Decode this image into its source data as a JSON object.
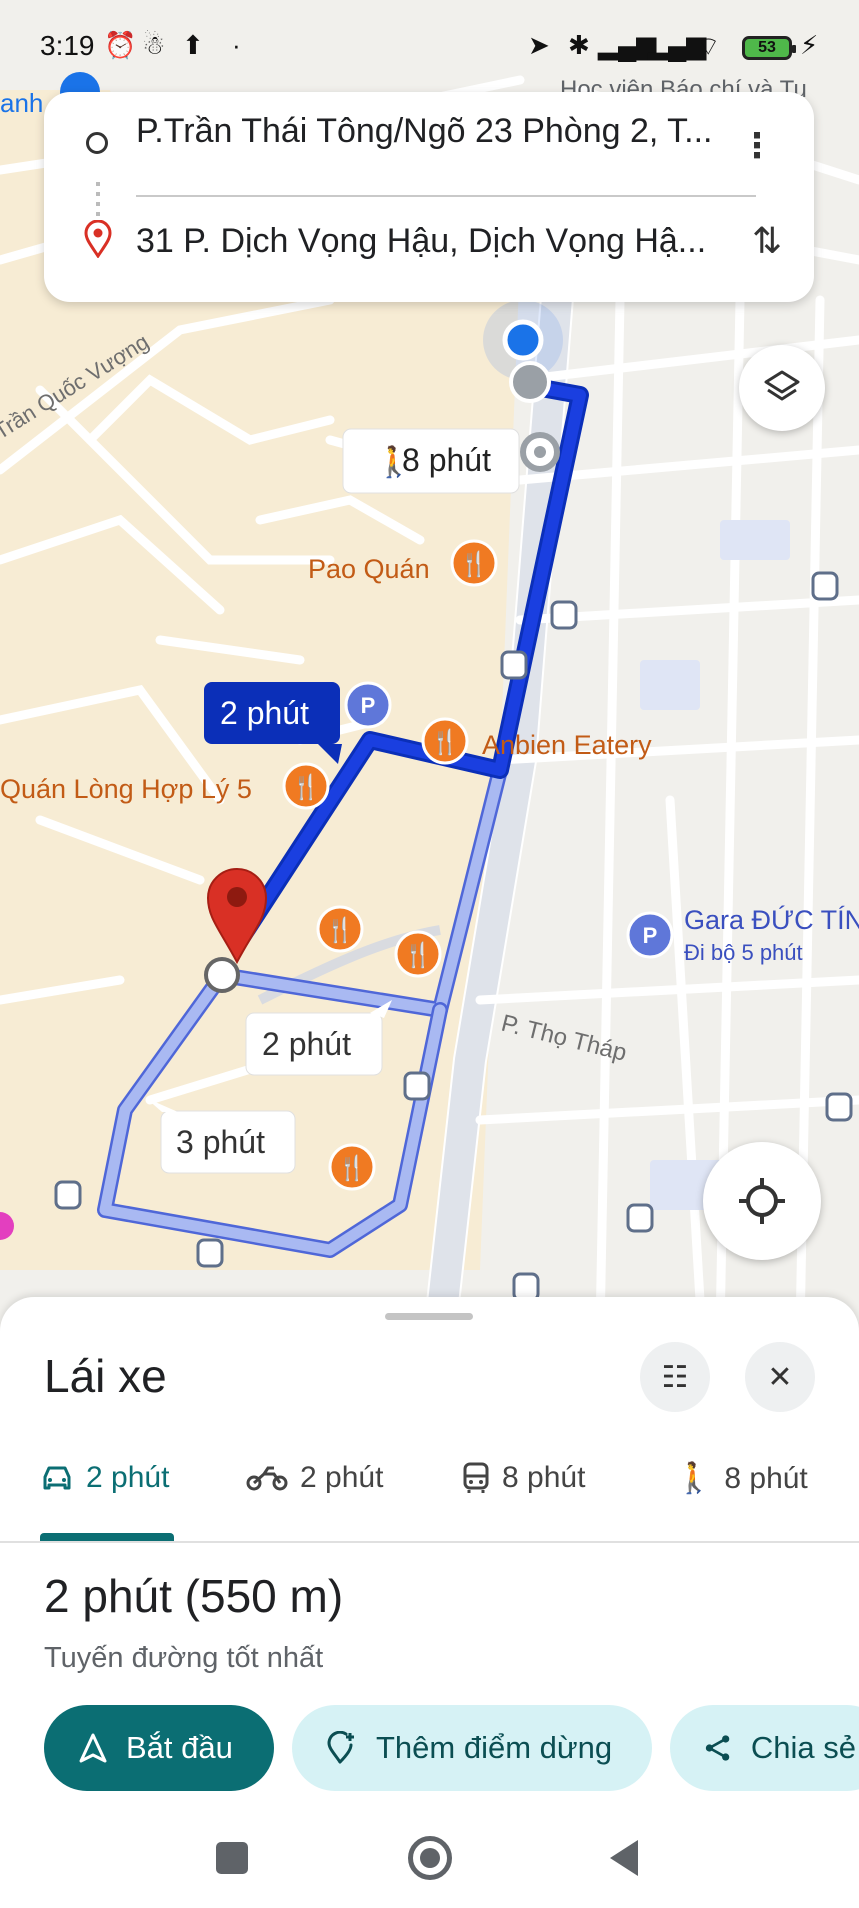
{
  "status_bar": {
    "time": "3:19",
    "battery": "53"
  },
  "search": {
    "origin": "P.Trần Thái Tông/Ngõ 23 Phòng 2, T...",
    "destination": "31 P. Dịch Vọng Hậu, Dịch Vọng Hậ..."
  },
  "map": {
    "labels": {
      "street_tran_quoc_vuong": "Trần Quốc Vượng",
      "top_left_partial": "anh",
      "top_right_place": "Học viện Báo chí và Tu",
      "pao_quan": "Pao Quán",
      "anbien": "Anbien Eatery",
      "quan_long": "Quán Lòng Hợp Lý 5",
      "gara": "Gara ĐỨC TÍN",
      "gara_walk": "Đi bộ 5 phút",
      "tho_thap": "P. Thọ Tháp"
    },
    "callouts": {
      "walk": "8 phút",
      "selected": "2 phút",
      "alt1": "2 phút",
      "alt2": "3 phút"
    }
  },
  "sheet": {
    "title": "Lái xe",
    "tabs": [
      {
        "label": "2 phút",
        "icon": "car-icon",
        "active": true
      },
      {
        "label": "2 phút",
        "icon": "motorbike-icon",
        "active": false
      },
      {
        "label": "8 phút",
        "icon": "transit-icon",
        "active": false
      },
      {
        "label": "8 phút",
        "icon": "walk-icon",
        "active": false
      }
    ],
    "route_time": "2 phút (550 m)",
    "route_subtitle": "Tuyến đường tốt nhất",
    "start_label": "Bắt đầu",
    "add_stop_label": "Thêm điểm dừng",
    "share_label": "Chia sẻ"
  },
  "colors": {
    "route_primary": "#1a3fe0",
    "route_alt": "#a9b9f2",
    "accent": "#0b6e73",
    "poi_food": "#f07a22",
    "destination_pin": "#d93025"
  }
}
